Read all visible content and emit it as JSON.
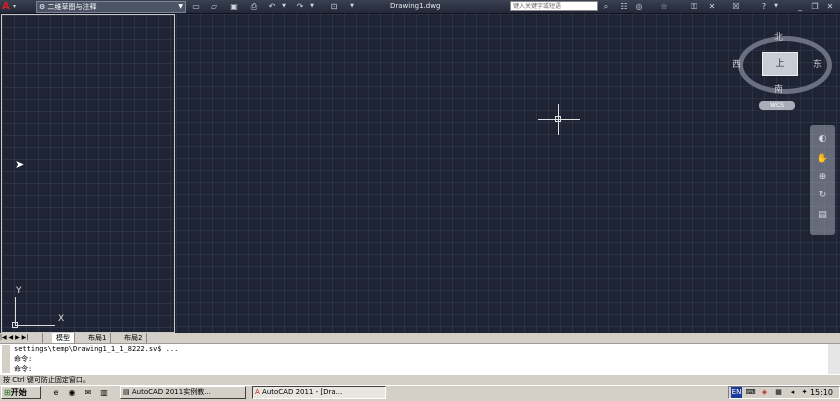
{
  "titlebar": {
    "app_icon": "A",
    "workspace": "二维草图与注释",
    "document_title": "Drawing1.dwg",
    "search_placeholder": "键入关键字或短语",
    "quick_access_icons": [
      "new-icon",
      "open-icon",
      "save-icon",
      "print-icon",
      "undo-icon",
      "redo-icon"
    ],
    "right_icons": [
      "search-icon",
      "key-icon",
      "star-icon",
      "exchange-icon",
      "help-icon"
    ],
    "window_controls": [
      "minimize",
      "restore",
      "close"
    ]
  },
  "viewcube": {
    "north": "北",
    "south": "南",
    "east": "东",
    "west": "西",
    "face": "上",
    "wcs_label": "WCS"
  },
  "ucs": {
    "x_label": "X",
    "y_label": "Y"
  },
  "tabs": [
    {
      "label": "模型",
      "active": true
    },
    {
      "label": "布局1",
      "active": false
    },
    {
      "label": "布局2",
      "active": false
    }
  ],
  "command_line": {
    "history": [
      "settings\\temp\\Drawing1_1_1_8222.sv$ ...",
      "命令:"
    ],
    "prompt": "命令:"
  },
  "status": {
    "text": "按 Ctrl 键可防止固定窗口。"
  },
  "taskbar": {
    "start_label": "开始",
    "buttons": [
      {
        "label": "AutoCAD 2011实例教...",
        "active": false
      },
      {
        "label": "AutoCAD 2011 - [Dra...",
        "active": true
      }
    ],
    "tray_lang": "EN",
    "clock": "15:10"
  }
}
